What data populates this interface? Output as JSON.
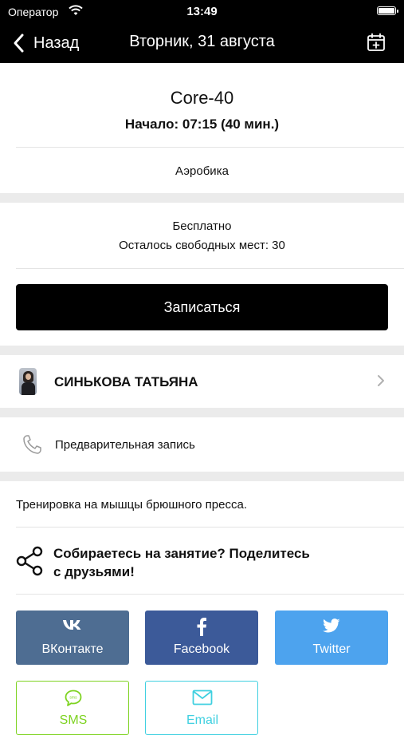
{
  "status_bar": {
    "carrier": "Оператор",
    "time": "13:49"
  },
  "nav": {
    "back_label": "Назад",
    "title": "Вторник, 31 августа"
  },
  "class_info": {
    "name": "Core-40",
    "start": "Начало: 07:15 (40 мин.)",
    "category": "Аэробика"
  },
  "pricing": {
    "price": "Бесплатно",
    "spots": "Осталось свободных мест: 30"
  },
  "signup_label": "Записаться",
  "trainer": {
    "name": "СИНЬКОВА ТАТЬЯНА"
  },
  "booking": {
    "label": "Предварительная запись"
  },
  "description": "Тренировка на мышцы брюшного пресса.",
  "share": {
    "prompt_line1": "Собираетесь на занятие? Поделитесь",
    "prompt_line2": "с друзьями!",
    "buttons": [
      {
        "label": "ВКонтакте",
        "icon": "vk-icon",
        "color": "#4e6d92"
      },
      {
        "label": "Facebook",
        "icon": "facebook-icon",
        "color": "#3c5a99"
      },
      {
        "label": "Twitter",
        "icon": "twitter-icon",
        "color": "#4da3ee"
      },
      {
        "label": "SMS",
        "icon": "sms-icon",
        "color": "#7ed321"
      },
      {
        "label": "Email",
        "icon": "email-icon",
        "color": "#3fd0e0"
      }
    ]
  }
}
